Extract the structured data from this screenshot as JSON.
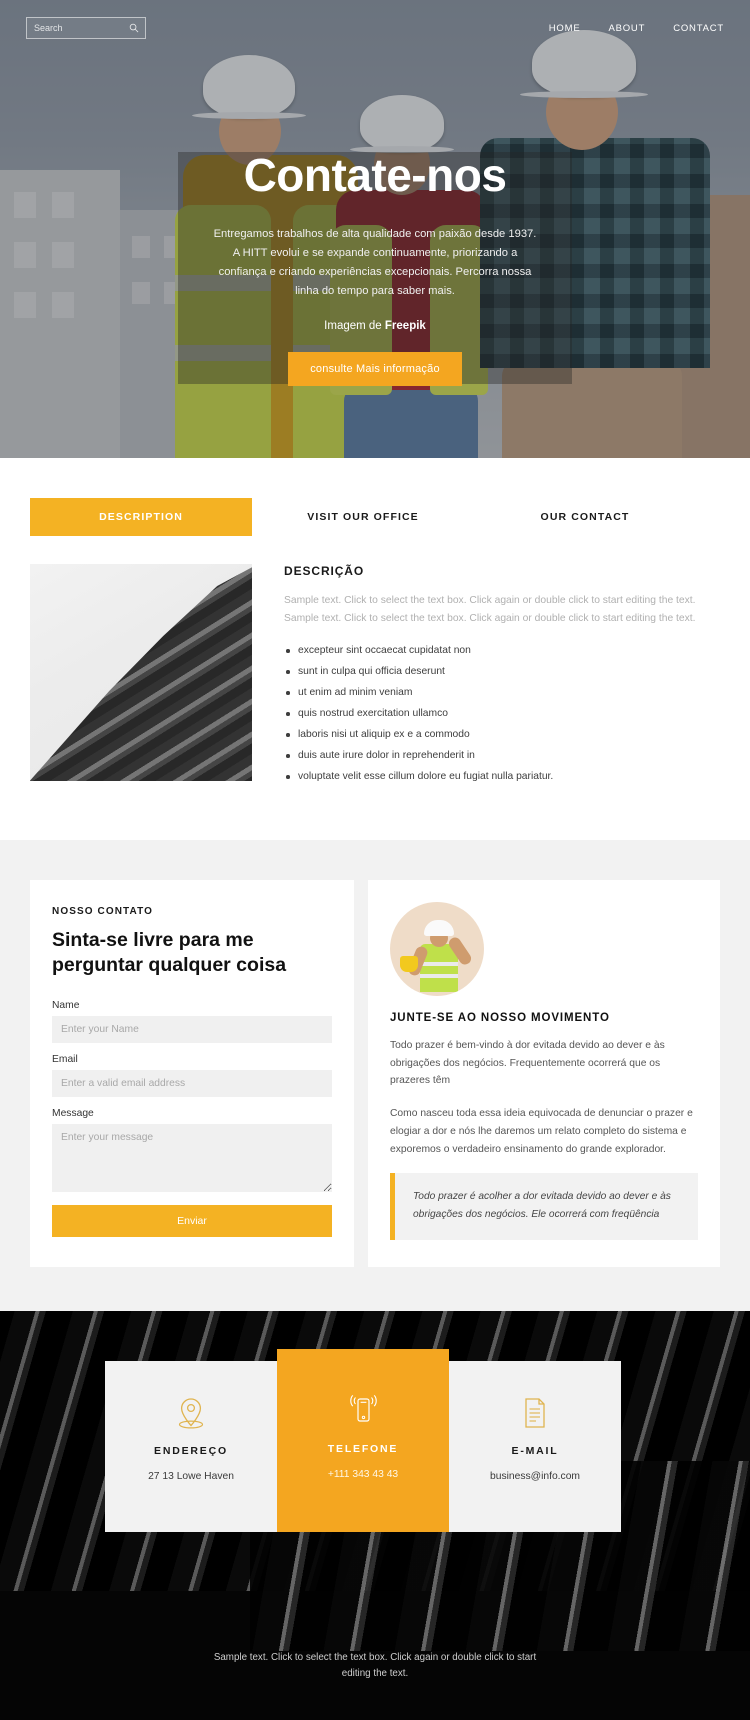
{
  "topbar": {
    "search_placeholder": "Search",
    "search_value": "",
    "search_icon": "search-icon",
    "nav": [
      {
        "label": "HOME"
      },
      {
        "label": "ABOUT"
      },
      {
        "label": "CONTACT"
      }
    ]
  },
  "hero": {
    "title": "Contate-nos",
    "subtitle": "Entregamos trabalhos de alta qualidade com paixão desde 1937. A HITT evolui e se expande continuamente, priorizando a confiança e criando experiências excepcionais. Percorra nossa linha do tempo para saber mais.",
    "credit_prefix": "Imagem de ",
    "credit_source": "Freepik",
    "cta_label": "consulte Mais informação",
    "accent_color": "#f4a620"
  },
  "tabs": {
    "items": [
      {
        "label": "DESCRIPTION",
        "active": true
      },
      {
        "label": "VISIT OUR OFFICE",
        "active": false
      },
      {
        "label": "OUR CONTACT",
        "active": false
      }
    ],
    "active_color": "#f4b223"
  },
  "description": {
    "image_alt": "architectural-facade-photo",
    "heading": "DESCRIÇÃO",
    "paragraph": "Sample text. Click to select the text box. Click again or double click to start editing the text. Sample text. Click to select the text box. Click again or double click to start editing the text.",
    "bullets": [
      "excepteur sint occaecat cupidatat non",
      "sunt in culpa qui officia deserunt",
      "ut enim ad minim veniam",
      "quis nostrud exercitation ullamco",
      "laboris nisi ut aliquip ex e a commodo",
      "duis aute irure dolor in reprehenderit in",
      "voluptate velit esse cillum dolore eu fugiat nulla pariatur."
    ]
  },
  "contact_form": {
    "kicker": "NOSSO CONTATO",
    "title": "Sinta-se livre para me perguntar qualquer coisa",
    "fields": [
      {
        "label": "Name",
        "placeholder": "Enter your Name",
        "value": ""
      },
      {
        "label": "Email",
        "placeholder": "Enter a valid email address",
        "value": ""
      },
      {
        "label": "Message",
        "placeholder": "Enter your message",
        "value": ""
      }
    ],
    "submit_label": "Enviar"
  },
  "movement": {
    "avatar_alt": "construction-worker-avatar",
    "heading": "JUNTE-SE AO NOSSO MOVIMENTO",
    "paragraph1": "Todo prazer é bem-vindo à dor evitada devido ao dever e às obrigações dos negócios. Frequentemente ocorrerá que os prazeres têm",
    "paragraph2": "Como nasceu toda essa ideia equivocada de denunciar o prazer e elogiar a dor e nós lhe daremos um relato completo do sistema e exporemos o verdadeiro ensinamento do grande explorador.",
    "quote": "Todo prazer é acolher a dor evitada devido ao dever e às obrigações dos negócios. Ele ocorrerá com freqüência"
  },
  "contact_cards": [
    {
      "icon": "map-pin-icon",
      "title": "ENDEREÇO",
      "value": "27 13 Lowe Haven",
      "highlight": false
    },
    {
      "icon": "mobile-phone-icon",
      "title": "TELEFONE",
      "value": "+111 343 43 43",
      "highlight": true
    },
    {
      "icon": "document-icon",
      "title": "E-MAIL",
      "value": "business@info.com",
      "highlight": false
    }
  ],
  "footer": {
    "note": "Sample text. Click to select the text box. Click again or double click to start editing the text."
  }
}
